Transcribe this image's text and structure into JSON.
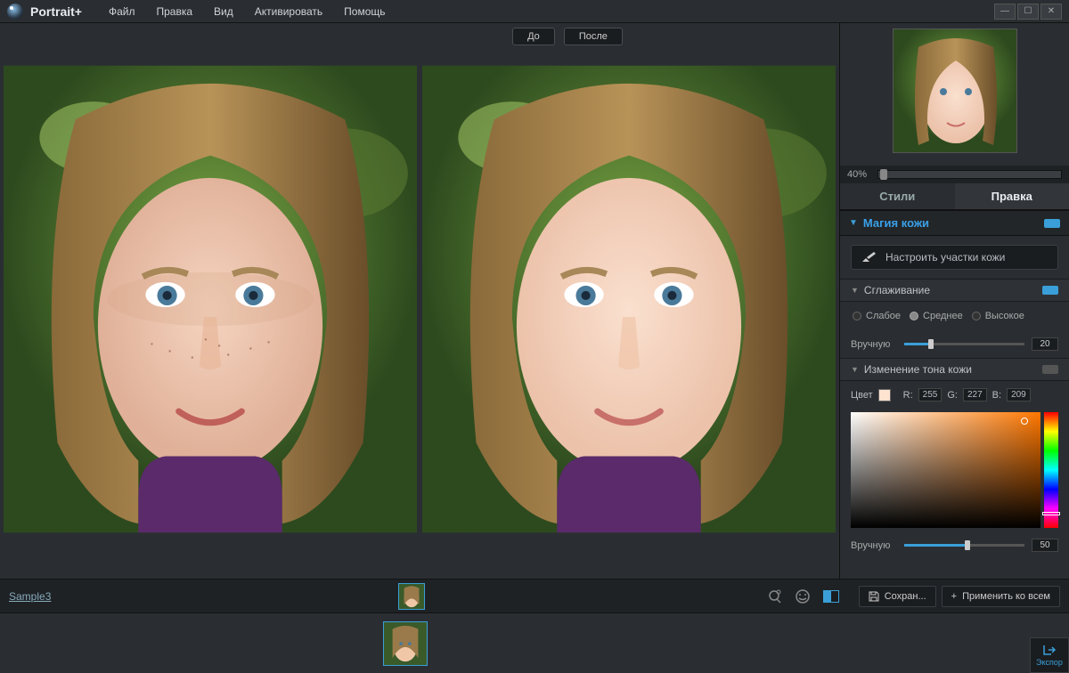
{
  "app": {
    "title": "Portrait+"
  },
  "menu": {
    "file": "Файл",
    "edit": "Правка",
    "view": "Вид",
    "activate": "Активировать",
    "help": "Помощь"
  },
  "viewer": {
    "before": "До",
    "after": "После"
  },
  "preview": {
    "zoom": "40%"
  },
  "tabs": {
    "styles": "Стили",
    "edit": "Правка"
  },
  "skin": {
    "section": "Магия кожи",
    "adjust_btn": "Настроить участки кожи",
    "smoothing": "Сглаживание",
    "opt_low": "Слабое",
    "opt_med": "Среднее",
    "opt_high": "Высокое",
    "manual": "Вручную",
    "smooth_val": "20",
    "tone": "Изменение тона кожи",
    "color_lbl": "Цвет",
    "r_lbl": "R:",
    "g_lbl": "G:",
    "B_lbl": "B:",
    "r": "255",
    "g": "227",
    "b": "209",
    "tone_val": "50"
  },
  "status": {
    "filename": "Sample3",
    "save": "Сохран...",
    "apply_all": "Применить ко всем",
    "export": "Экспор"
  }
}
